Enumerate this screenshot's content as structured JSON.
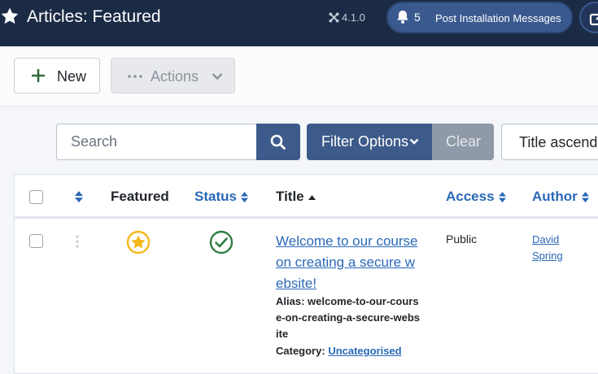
{
  "header": {
    "title": "Articles: Featured",
    "version": "4.1.0",
    "notifications_count": "5",
    "post_install_label": "Post Installation Messages"
  },
  "toolbar": {
    "new_label": "New",
    "actions_label": "Actions"
  },
  "filters": {
    "search_placeholder": "Search",
    "filter_options_label": "Filter Options",
    "clear_label": "Clear",
    "sort_label": "Title ascending"
  },
  "table": {
    "columns": {
      "featured": "Featured",
      "status": "Status",
      "title": "Title",
      "access": "Access",
      "author": "Author"
    },
    "rows": [
      {
        "title": "Welcome to our course on creating a secure website!",
        "alias_label": "Alias:",
        "alias": "welcome-to-our-course-on-creating-a-secure-website",
        "category_label": "Category:",
        "category": "Uncategorised",
        "access": "Public",
        "author": "David Spring",
        "featured": true,
        "published": true
      }
    ]
  },
  "colors": {
    "header_bg": "#1c2b45",
    "primary": "#3d5b8a",
    "link": "#2a69b8",
    "featured_star": "#f5b81a",
    "published_check": "#2e7d42"
  },
  "icons": {
    "header": [
      "star-icon",
      "joomla-icon",
      "bell-icon",
      "external-link-icon"
    ],
    "toolbar": [
      "plus-icon",
      "ellipsis-icon",
      "chevron-down-icon"
    ],
    "filters": [
      "search-icon",
      "caret-down-icon"
    ],
    "table": [
      "sort-icon",
      "sort-up-icon",
      "drag-handle-icon",
      "featured-star-icon",
      "check-circle-icon"
    ]
  }
}
